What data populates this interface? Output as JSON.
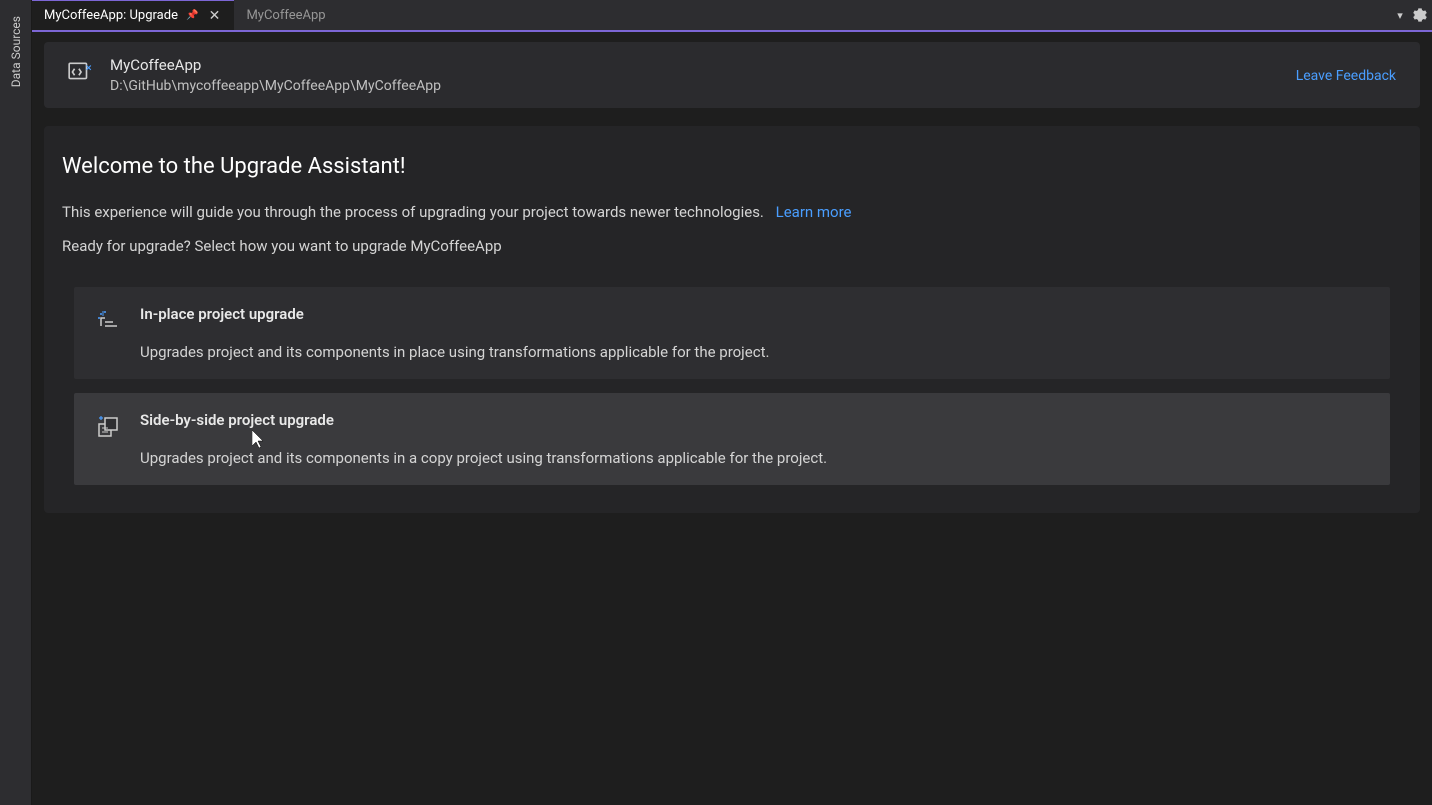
{
  "sidebar": {
    "vertical_tab": "Data Sources"
  },
  "tabs": {
    "active": {
      "label": "MyCoffeeApp: Upgrade"
    },
    "inactive": {
      "label": "MyCoffeeApp"
    }
  },
  "header": {
    "project_name": "MyCoffeeApp",
    "project_path": "D:\\GitHub\\mycoffeeapp\\MyCoffeeApp\\MyCoffeeApp",
    "feedback_link": "Leave Feedback"
  },
  "content": {
    "welcome_title": "Welcome to the Upgrade Assistant!",
    "welcome_subtitle": "This experience will guide you through the process of upgrading your project towards newer technologies.",
    "learn_more": "Learn more",
    "ready_text": "Ready for upgrade? Select how you want to upgrade MyCoffeeApp",
    "options": [
      {
        "title": "In-place project upgrade",
        "description": "Upgrades project and its components in place using transformations applicable for the project."
      },
      {
        "title": "Side-by-side project upgrade",
        "description": "Upgrades project and its components in a copy project using transformations applicable for the project."
      }
    ]
  }
}
